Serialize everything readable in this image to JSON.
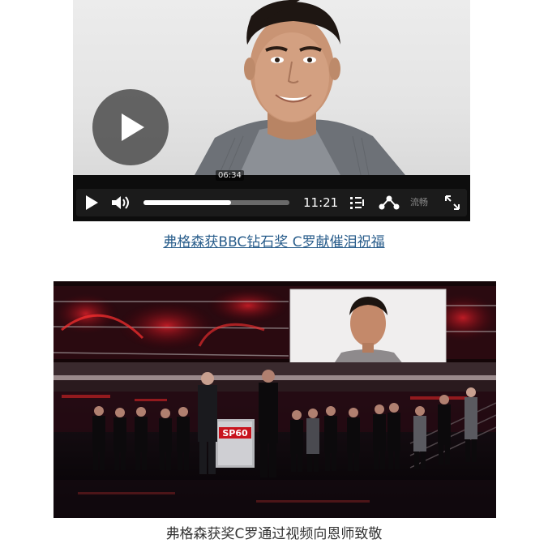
{
  "video": {
    "hover_time": "06:34",
    "duration": "11:21",
    "progress_fraction": 0.6,
    "quality_label": "流畅",
    "icons": [
      "play-icon",
      "volume-icon",
      "playlist-icon",
      "share-icon",
      "fullscreen-icon"
    ]
  },
  "video_link_caption": "弗格森获BBC钻石奖 C罗献催泪祝福",
  "photo_caption": "弗格森获奖C罗通过视频向恩师致敬",
  "photo": {
    "stage_logo": "SP60"
  },
  "colors": {
    "link": "#2a5e8c",
    "caption": "#333333",
    "player_bg": "#0d0d0d",
    "stage_red": "#c8141e"
  }
}
